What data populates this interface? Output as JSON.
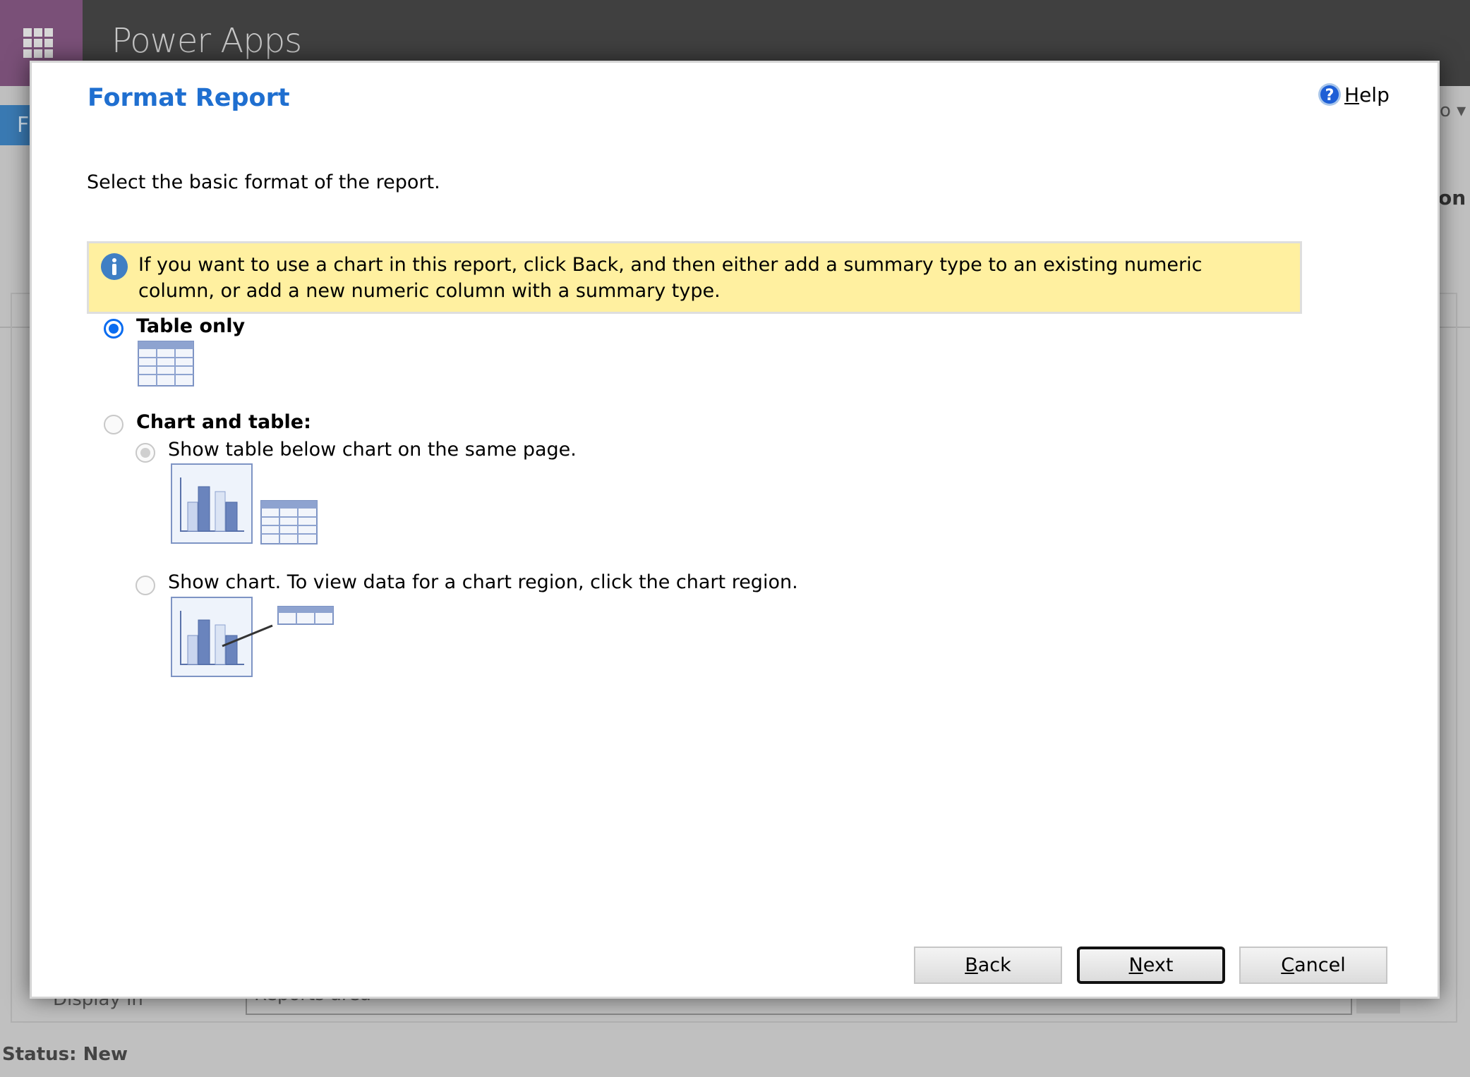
{
  "app": {
    "title": "Power Apps"
  },
  "background": {
    "tab_fragment": "F",
    "right_fragment_1": "o ▾",
    "right_fragment_2": "on",
    "display_in_label": "Display in",
    "display_in_value": "Reports area",
    "ellipsis": "...",
    "status": "Status: New"
  },
  "dialog": {
    "title": "Format Report",
    "help": {
      "accesskey": "H",
      "rest": "elp",
      "icon": "help-circle-icon"
    },
    "subtitle": "Select the basic format of the report.",
    "info": {
      "icon": "info-icon",
      "text": "If you want to use a chart in this report, click Back, and then either add a summary type to an existing numeric column, or add a new numeric column with a summary type."
    },
    "options": {
      "table_only": {
        "label": "Table only",
        "selected": true
      },
      "chart_and_table": {
        "label": "Chart and table:",
        "selected": false
      },
      "table_below_chart": {
        "label": "Show table below chart on the same page.",
        "selected": true,
        "disabled": true
      },
      "chart_drilldown": {
        "label": "Show chart. To view data for a chart region, click the chart region.",
        "selected": false,
        "disabled": true
      }
    },
    "buttons": {
      "back": {
        "accesskey": "B",
        "rest": "ack"
      },
      "next": {
        "accesskey": "N",
        "rest": "ext"
      },
      "cancel": {
        "accesskey": "C",
        "rest": "ancel"
      }
    }
  },
  "colors": {
    "accent": "#1f6fd0",
    "radio_selected": "#0a6cf0",
    "info_bg": "#fff0a0",
    "topbar": "#404040",
    "waffle": "#7a5078"
  }
}
